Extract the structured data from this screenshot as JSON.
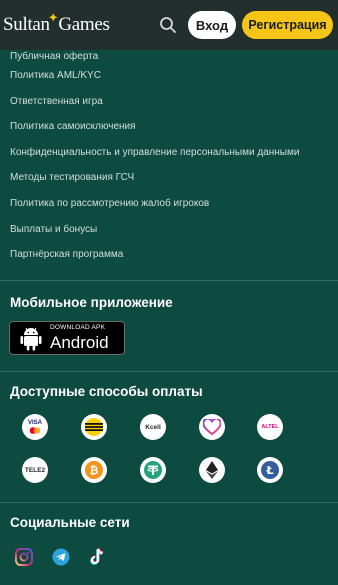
{
  "header": {
    "logo_text_1": "Sultan",
    "logo_text_2": "Games",
    "login_label": "Вход",
    "register_label": "Регистрация"
  },
  "links": [
    "Публичная оферта",
    "Политика AML/KYC",
    "Ответственная игра",
    "Политика самоисключения",
    "Конфиденциальность и управление персональными данными",
    "Методы тестирования ГСЧ",
    "Политика по рассмотрению жалоб игроков",
    "Выплаты и бонусы",
    "Партнёрская программа"
  ],
  "mobile": {
    "title": "Мобильное приложение",
    "apk_small": "DOWNLOAD APK",
    "apk_big": "Android"
  },
  "payments": {
    "title": "Доступные способы оплаты",
    "icons": {
      "visa": "VISA",
      "kcell": "Kcell",
      "altel": "ALTEL",
      "tele2": "TELE2"
    }
  },
  "social": {
    "title": "Социальные сети"
  },
  "colors": {
    "background": "#0d4a40",
    "header": "#232f2c",
    "accent": "#f5c518"
  }
}
